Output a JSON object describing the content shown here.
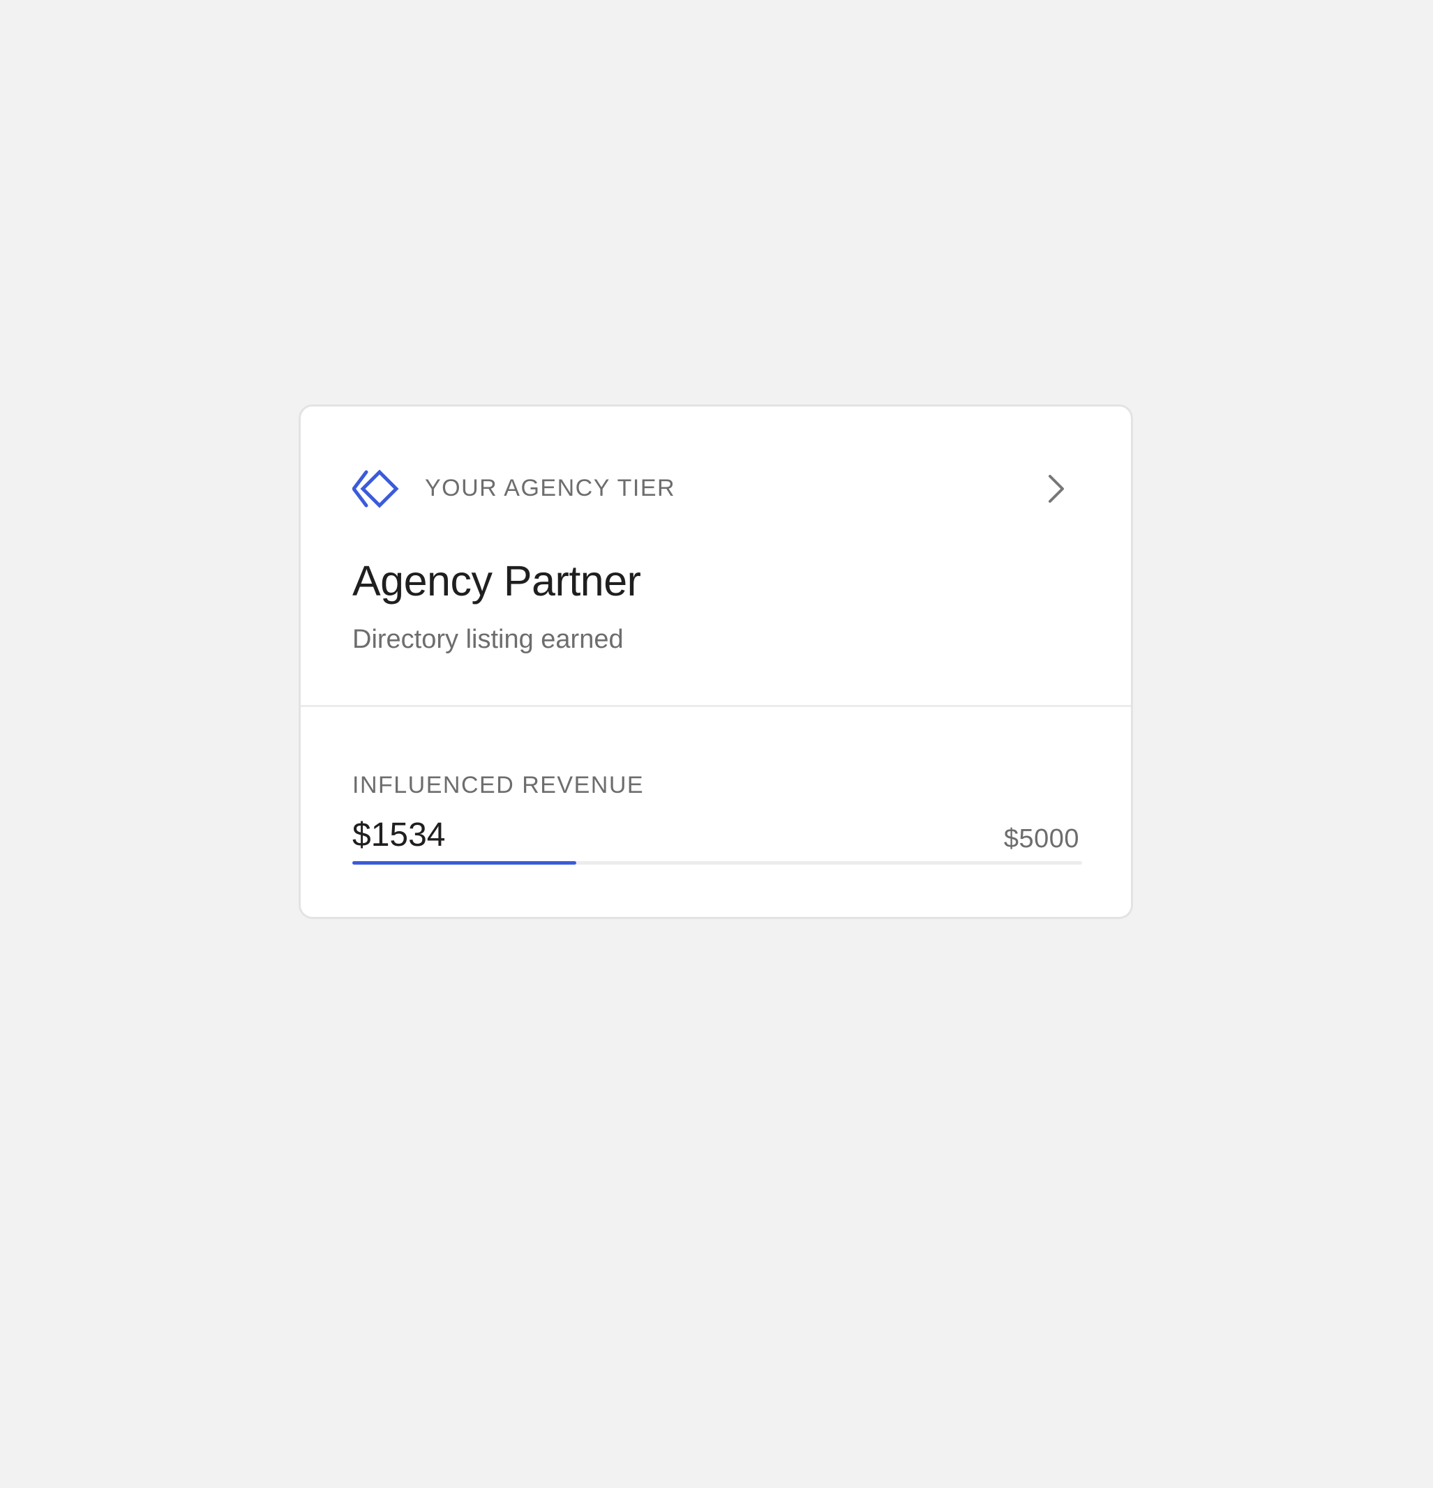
{
  "theme": {
    "accent": "#3b5bdb",
    "background": "#f2f2f2",
    "card_background": "#ffffff",
    "text_primary": "#1f1f1f",
    "text_secondary": "#6d6d6d"
  },
  "tier_card": {
    "icon": "double-diamond-icon",
    "header_label": "YOUR AGENCY TIER",
    "action_icon": "chevron-right-icon",
    "tier_name": "Agency Partner",
    "tier_status": "Directory listing earned"
  },
  "revenue": {
    "label": "INFLUENCED REVENUE",
    "current_display": "$1534",
    "goal_display": "$5000",
    "current_value": 1534,
    "goal_value": 5000
  }
}
